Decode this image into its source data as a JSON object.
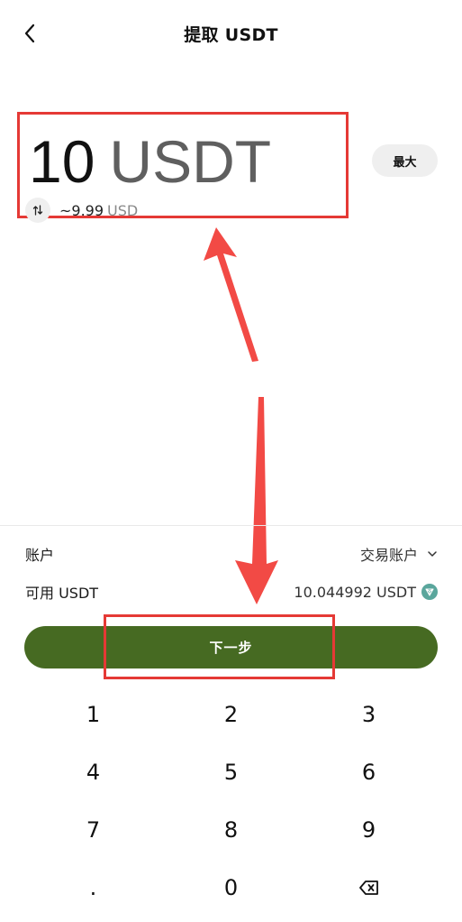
{
  "header": {
    "title": "提取 USDT",
    "back_icon": "chevron-left-icon"
  },
  "amount": {
    "value": "10",
    "unit": "USDT",
    "converted_value": "~9.99",
    "converted_unit": "USD",
    "swap_icon": "swap-vertical-icon"
  },
  "max_button": {
    "label": "最大"
  },
  "account_row": {
    "label": "账户",
    "value": "交易账户",
    "icon": "chevron-down-icon"
  },
  "available_row": {
    "label": "可用 USDT",
    "value": "10.044992 USDT",
    "icon": "tron-icon"
  },
  "next_button": {
    "label": "下一步"
  },
  "keypad": {
    "keys": [
      "1",
      "2",
      "3",
      "4",
      "5",
      "6",
      "7",
      "8",
      "9",
      ".",
      "0"
    ],
    "delete_icon": "backspace-icon"
  },
  "colors": {
    "primary": "#466a22",
    "annotation": "#e53935",
    "tron": "#5aa69c"
  }
}
